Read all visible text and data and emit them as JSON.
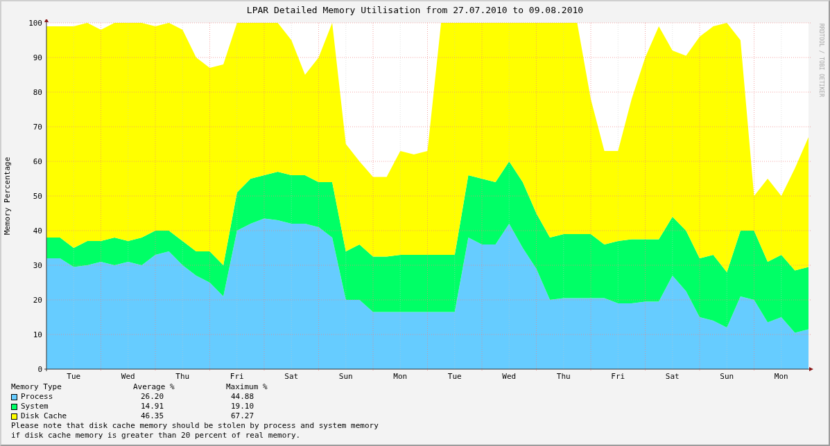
{
  "chart": {
    "credit": "RRDTOOL / TOBI OETIKER",
    "chart_data": {
      "type": "area",
      "title": "LPAR Detailed Memory Utilisation from 27.07.2010 to 09.08.2010",
      "ylabel": "Memory Percentage",
      "stacked": true,
      "grid": true,
      "ylim": [
        0,
        100
      ],
      "categories": [
        null,
        null,
        "Tue",
        null,
        null,
        null,
        "Wed",
        null,
        null,
        null,
        "Thu",
        null,
        null,
        null,
        "Fri",
        null,
        null,
        null,
        "Sat",
        null,
        null,
        null,
        "Sun",
        null,
        null,
        null,
        "Mon",
        null,
        null,
        null,
        "Tue",
        null,
        null,
        null,
        "Wed",
        null,
        null,
        null,
        "Thu",
        null,
        null,
        null,
        "Fri",
        null,
        null,
        null,
        "Sat",
        null,
        null,
        null,
        "Sun",
        null,
        null,
        null,
        "Mon",
        null,
        null
      ],
      "yticks": [
        0,
        10,
        20,
        30,
        40,
        50,
        60,
        70,
        80,
        90,
        100
      ],
      "series": [
        {
          "name": "Process",
          "color": "#66ccff",
          "values": [
            32,
            32,
            29.5,
            30,
            31,
            30,
            31,
            30,
            33,
            34,
            30,
            27,
            25,
            21,
            40,
            42,
            43.5,
            43,
            42,
            42,
            41,
            38,
            20,
            20,
            16.5,
            16.5,
            16.5,
            16.5,
            16.5,
            16.5,
            16.5,
            38,
            36,
            36,
            42,
            35,
            29,
            20,
            20.5,
            20.5,
            20.5,
            20.5,
            19,
            19,
            19.5,
            19.5,
            27,
            22.5,
            15,
            14,
            12,
            21,
            20,
            13.5,
            15,
            10.5,
            11.5
          ]
        },
        {
          "name": "System",
          "color": "#00ff66",
          "values": [
            6,
            6,
            5.5,
            7,
            6,
            8,
            6,
            8,
            7,
            6,
            7,
            7,
            9,
            9,
            11,
            13,
            12.5,
            14,
            14,
            14,
            13,
            16,
            14,
            16,
            16,
            16,
            16.5,
            16.5,
            16.5,
            16.5,
            16.5,
            18,
            19,
            18,
            18,
            19,
            16,
            18,
            18.5,
            18.5,
            18.5,
            15.5,
            18,
            18.5,
            18,
            18,
            17,
            17.5,
            17,
            19,
            16,
            19,
            20,
            17.5,
            18,
            18,
            18
          ]
        },
        {
          "name": "Disk Cache",
          "color": "#ffff00",
          "values": [
            61,
            61,
            64,
            63,
            61,
            62,
            63,
            62,
            59,
            60,
            61,
            56,
            53,
            58,
            49,
            45,
            44,
            43,
            39,
            29,
            36,
            46,
            31,
            24,
            23,
            23,
            30,
            29,
            30,
            67,
            67,
            44,
            45,
            46,
            40,
            46,
            55,
            62,
            61,
            61,
            39,
            27,
            26,
            40.5,
            52.5,
            61.5,
            48,
            50.5,
            64,
            66,
            72,
            55,
            10,
            24,
            17,
            29.5,
            37.5
          ]
        }
      ]
    }
  },
  "legend": {
    "headers": [
      "Memory Type",
      "Average %",
      "Maximum %"
    ],
    "rows": [
      {
        "average": "26.20",
        "maximum": "44.88"
      },
      {
        "average": "14.91",
        "maximum": "19.10"
      },
      {
        "average": "46.35",
        "maximum": "67.27"
      }
    ],
    "note": [
      "Please note that disk cache memory should be stolen by process and system memory",
      "if disk cache memory is greater than 20 percent of real memory."
    ]
  }
}
